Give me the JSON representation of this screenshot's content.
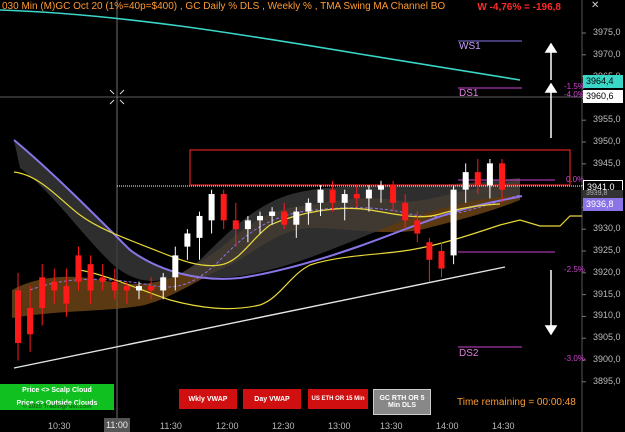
{
  "header": {
    "title": "030 Min (M)GC  Oct 20 (1%=40p=$400) , GC Daily % DLS , Weekly % , TMA Swing MA Channel BO",
    "pl": "W -4,76% = -196,8"
  },
  "levels": {
    "ws1": "WS1",
    "ds1": "DS1",
    "ds2": "DS2",
    "pct_plus_1_5": "-1.5%",
    "pct_plus_4": "-4.0%",
    "pct_0": "0.0%",
    "pct_minus_2_5": "-2.5%",
    "pct_minus_3": "-3.0%"
  },
  "price_axis": {
    "ticks": [
      "3975,0",
      "3970,0",
      "3965,0",
      "3960,0",
      "3955,0",
      "3950,0",
      "3945,0",
      "3940,0",
      "3935,0",
      "3930,0",
      "3925,0",
      "3920,0",
      "3915,0",
      "3910,0",
      "3905,0",
      "3900,0",
      "3895,0"
    ]
  },
  "price_tags": {
    "cyan": "3964,4",
    "white_top": "3960,6",
    "current": "3941,0",
    "hidden": "3939,8",
    "purple": "3936,8"
  },
  "time_axis": {
    "ticks": [
      "10:30",
      "11:00",
      "11:30",
      "12:00",
      "12:30",
      "13:00",
      "13:30",
      "14:00",
      "14:30"
    ]
  },
  "buttons": {
    "scalp": "Price <> Scalp Cloud",
    "outside": "Price <> Outside Clouds",
    "watermark": "© 2020 TradingFuel.com",
    "wkly_vwap": "Wkly VWAP",
    "day_vwap": "Day VWAP",
    "us_eth": "US ETH OR 15 Min",
    "gc_rth": "GC RTH OR 5 Min DLS"
  },
  "time_remaining": "Time remaining = 00:00:48",
  "colors": {
    "up_candle": "#ffffff",
    "down_candle": "#ff1a1a",
    "cyan_ma": "#3ad6c8",
    "purple_ma": "#8a74e8",
    "yellow_band": "#e8d83a",
    "cloud": "#8a5a20",
    "scalp_button_bg": "#10c020",
    "vwap_button_bg": "#d01010",
    "gc_button_bg": "#888888"
  },
  "chart_data": {
    "type": "candlestick",
    "timeframe": "30 min",
    "x_ticks": [
      "10:30",
      "11:00",
      "11:30",
      "12:00",
      "12:30",
      "13:00",
      "13:30",
      "14:00",
      "14:30"
    ],
    "ylim": [
      3893,
      3982
    ],
    "candles": [
      {
        "o": 3918,
        "h": 3922,
        "l": 3902,
        "c": 3906
      },
      {
        "o": 3914,
        "h": 3919,
        "l": 3904,
        "c": 3908
      },
      {
        "o": 3921,
        "h": 3924,
        "l": 3910,
        "c": 3914
      },
      {
        "o": 3920,
        "h": 3923,
        "l": 3915,
        "c": 3918
      },
      {
        "o": 3919,
        "h": 3923,
        "l": 3912,
        "c": 3915
      },
      {
        "o": 3926,
        "h": 3928,
        "l": 3918,
        "c": 3920
      },
      {
        "o": 3924,
        "h": 3926,
        "l": 3915,
        "c": 3918
      },
      {
        "o": 3921,
        "h": 3924,
        "l": 3918,
        "c": 3920
      },
      {
        "o": 3920,
        "h": 3923,
        "l": 3916,
        "c": 3918
      },
      {
        "o": 3919,
        "h": 3920,
        "l": 3915,
        "c": 3918
      },
      {
        "o": 3918,
        "h": 3920,
        "l": 3916,
        "c": 3919
      },
      {
        "o": 3919,
        "h": 3921,
        "l": 3916,
        "c": 3918
      },
      {
        "o": 3918,
        "h": 3922,
        "l": 3916,
        "c": 3921
      },
      {
        "o": 3921,
        "h": 3928,
        "l": 3918,
        "c": 3926
      },
      {
        "o": 3928,
        "h": 3932,
        "l": 3925,
        "c": 3931
      },
      {
        "o": 3930,
        "h": 3936,
        "l": 3925,
        "c": 3935
      },
      {
        "o": 3934,
        "h": 3941,
        "l": 3931,
        "c": 3940
      },
      {
        "o": 3940,
        "h": 3941,
        "l": 3932,
        "c": 3934
      },
      {
        "o": 3934,
        "h": 3938,
        "l": 3928,
        "c": 3932
      },
      {
        "o": 3932,
        "h": 3935,
        "l": 3929,
        "c": 3934
      },
      {
        "o": 3934,
        "h": 3936,
        "l": 3931,
        "c": 3935
      },
      {
        "o": 3935,
        "h": 3937,
        "l": 3933,
        "c": 3936
      },
      {
        "o": 3936,
        "h": 3938,
        "l": 3932,
        "c": 3933
      },
      {
        "o": 3933,
        "h": 3937,
        "l": 3930,
        "c": 3936
      },
      {
        "o": 3936,
        "h": 3939,
        "l": 3933,
        "c": 3938
      },
      {
        "o": 3938,
        "h": 3942,
        "l": 3935,
        "c": 3941
      },
      {
        "o": 3941,
        "h": 3943,
        "l": 3936,
        "c": 3938
      },
      {
        "o": 3938,
        "h": 3941,
        "l": 3934,
        "c": 3940
      },
      {
        "o": 3940,
        "h": 3942,
        "l": 3937,
        "c": 3939
      },
      {
        "o": 3939,
        "h": 3942,
        "l": 3936,
        "c": 3941
      },
      {
        "o": 3941,
        "h": 3943,
        "l": 3938,
        "c": 3942
      },
      {
        "o": 3942,
        "h": 3943,
        "l": 3936,
        "c": 3938
      },
      {
        "o": 3938,
        "h": 3940,
        "l": 3932,
        "c": 3934
      },
      {
        "o": 3934,
        "h": 3936,
        "l": 3929,
        "c": 3931
      },
      {
        "o": 3929,
        "h": 3930,
        "l": 3920,
        "c": 3925
      },
      {
        "o": 3927,
        "h": 3929,
        "l": 3921,
        "c": 3923
      },
      {
        "o": 3926,
        "h": 3942,
        "l": 3924,
        "c": 3941
      },
      {
        "o": 3941,
        "h": 3947,
        "l": 3938,
        "c": 3945
      },
      {
        "o": 3945,
        "h": 3948,
        "l": 3940,
        "c": 3942
      },
      {
        "o": 3942,
        "h": 3948,
        "l": 3939,
        "c": 3947
      },
      {
        "o": 3947,
        "h": 3948,
        "l": 3938,
        "c": 3941
      }
    ]
  }
}
